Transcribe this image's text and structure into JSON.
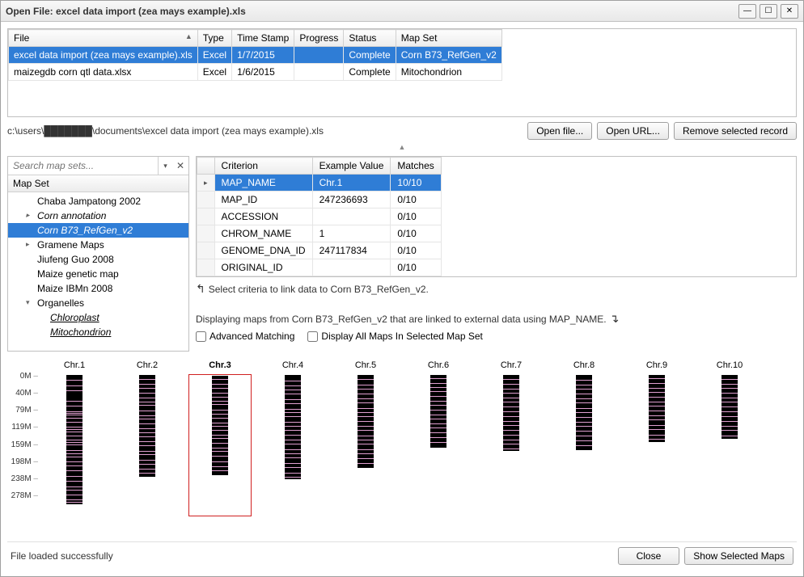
{
  "window": {
    "title": "Open File: excel data import (zea mays example).xls"
  },
  "file_table": {
    "headers": [
      "File",
      "Type",
      "Time Stamp",
      "Progress",
      "Status",
      "Map Set"
    ],
    "rows": [
      {
        "file": "excel data import (zea mays example).xls",
        "type": "Excel",
        "time": "1/7/2015",
        "progress": "",
        "status": "Complete",
        "mapset": "Corn B73_RefGen_v2",
        "selected": true
      },
      {
        "file": "maizegdb corn qtl data.xlsx",
        "type": "Excel",
        "time": "1/6/2015",
        "progress": "",
        "status": "Complete",
        "mapset": "Mitochondrion",
        "selected": false
      }
    ]
  },
  "path": "c:\\users\\███████\\documents\\excel data import (zea mays example).xls",
  "buttons": {
    "open_file": "Open file...",
    "open_url": "Open URL...",
    "remove": "Remove selected record",
    "close": "Close",
    "show_maps": "Show Selected Maps"
  },
  "search": {
    "placeholder": "Search map sets..."
  },
  "mapset_header": "Map Set",
  "tree": [
    {
      "label": "Chaba Jampatong 2002",
      "level": 1
    },
    {
      "label": "Corn annotation",
      "level": 1,
      "expander": "▸",
      "italic": true
    },
    {
      "label": "Corn B73_RefGen_v2",
      "level": 1,
      "selected": true,
      "italic": true
    },
    {
      "label": "Gramene Maps",
      "level": 1,
      "expander": "▸"
    },
    {
      "label": "Jiufeng Guo 2008",
      "level": 1
    },
    {
      "label": "Maize genetic map",
      "level": 1
    },
    {
      "label": "Maize IBMn 2008",
      "level": 1
    },
    {
      "label": "Organelles",
      "level": 1,
      "expander": "▾"
    },
    {
      "label": "Chloroplast",
      "level": 2,
      "underline": true
    },
    {
      "label": "Mitochondrion",
      "level": 2,
      "underline": true
    }
  ],
  "criteria": {
    "headers": [
      "Criterion",
      "Example Value",
      "Matches"
    ],
    "rows": [
      {
        "criterion": "MAP_NAME",
        "example": "Chr.1",
        "matches": "10/10",
        "selected": true,
        "pointer": true
      },
      {
        "criterion": "MAP_ID",
        "example": "247236693",
        "matches": "0/10"
      },
      {
        "criterion": "ACCESSION",
        "example": "",
        "matches": "0/10"
      },
      {
        "criterion": "CHROM_NAME",
        "example": "1",
        "matches": "0/10"
      },
      {
        "criterion": "GENOME_DNA_ID",
        "example": "247117834",
        "matches": "0/10"
      },
      {
        "criterion": "ORIGINAL_ID",
        "example": "",
        "matches": "0/10"
      }
    ]
  },
  "hint1": "Select criteria to link data to Corn B73_RefGen_v2.",
  "hint2": "Displaying maps from Corn B73_RefGen_v2 that are linked to external data using MAP_NAME.",
  "checks": {
    "advanced": "Advanced Matching",
    "display_all": "Display All Maps In Selected Map Set"
  },
  "status": "File loaded successfully",
  "chart_data": {
    "type": "bar",
    "title": "",
    "xlabel": "",
    "ylabel": "",
    "ylim": [
      0,
      300
    ],
    "yticks": [
      "0M",
      "40M",
      "79M",
      "119M",
      "159M",
      "198M",
      "238M",
      "278M"
    ],
    "yvals": [
      0,
      40,
      79,
      119,
      159,
      198,
      238,
      278
    ],
    "selected": "Chr.3",
    "series": [
      {
        "name": "Chr.1",
        "length": 300,
        "bands": [
          12,
          24,
          36,
          60,
          72,
          84,
          88,
          92,
          100,
          108,
          120,
          126,
          132,
          140,
          150,
          156,
          162,
          174,
          182,
          190,
          200,
          210,
          222,
          234,
          246,
          258,
          266,
          278,
          288,
          294
        ]
      },
      {
        "name": "Chr.2",
        "length": 236,
        "bands": [
          10,
          20,
          30,
          42,
          52,
          62,
          70,
          82,
          94,
          102,
          112,
          124,
          134,
          142,
          154,
          164,
          176,
          184,
          196,
          206,
          218,
          226
        ]
      },
      {
        "name": "Chr.3",
        "length": 230,
        "bands": [
          8,
          18,
          28,
          40,
          48,
          58,
          66,
          78,
          88,
          98,
          108,
          116,
          126,
          136,
          144,
          156,
          166,
          174,
          186,
          198,
          210,
          220
        ]
      },
      {
        "name": "Chr.4",
        "length": 242,
        "bands": [
          14,
          24,
          34,
          44,
          56,
          66,
          78,
          86,
          96,
          108,
          118,
          128,
          138,
          150,
          160,
          172,
          182,
          192,
          204,
          214,
          226,
          236
        ]
      },
      {
        "name": "Chr.5",
        "length": 216,
        "bands": [
          10,
          22,
          32,
          44,
          54,
          64,
          76,
          86,
          96,
          106,
          118,
          128,
          140,
          150,
          160,
          172,
          182,
          194,
          204
        ]
      },
      {
        "name": "Chr.6",
        "length": 168,
        "bands": [
          8,
          18,
          28,
          38,
          48,
          60,
          70,
          80,
          92,
          102,
          112,
          122,
          134,
          144,
          156
        ]
      },
      {
        "name": "Chr.7",
        "length": 176,
        "bands": [
          10,
          20,
          32,
          42,
          52,
          62,
          74,
          84,
          96,
          106,
          116,
          128,
          138,
          150,
          160,
          170
        ]
      },
      {
        "name": "Chr.8",
        "length": 174,
        "bands": [
          12,
          22,
          32,
          44,
          54,
          64,
          76,
          86,
          98,
          108,
          118,
          130,
          140,
          152,
          164
        ]
      },
      {
        "name": "Chr.9",
        "length": 156,
        "bands": [
          8,
          18,
          30,
          40,
          50,
          62,
          72,
          82,
          94,
          104,
          116,
          126,
          138,
          148
        ]
      },
      {
        "name": "Chr.10",
        "length": 148,
        "bands": [
          10,
          20,
          30,
          42,
          52,
          62,
          74,
          84,
          96,
          106,
          118,
          128,
          140
        ]
      }
    ]
  }
}
